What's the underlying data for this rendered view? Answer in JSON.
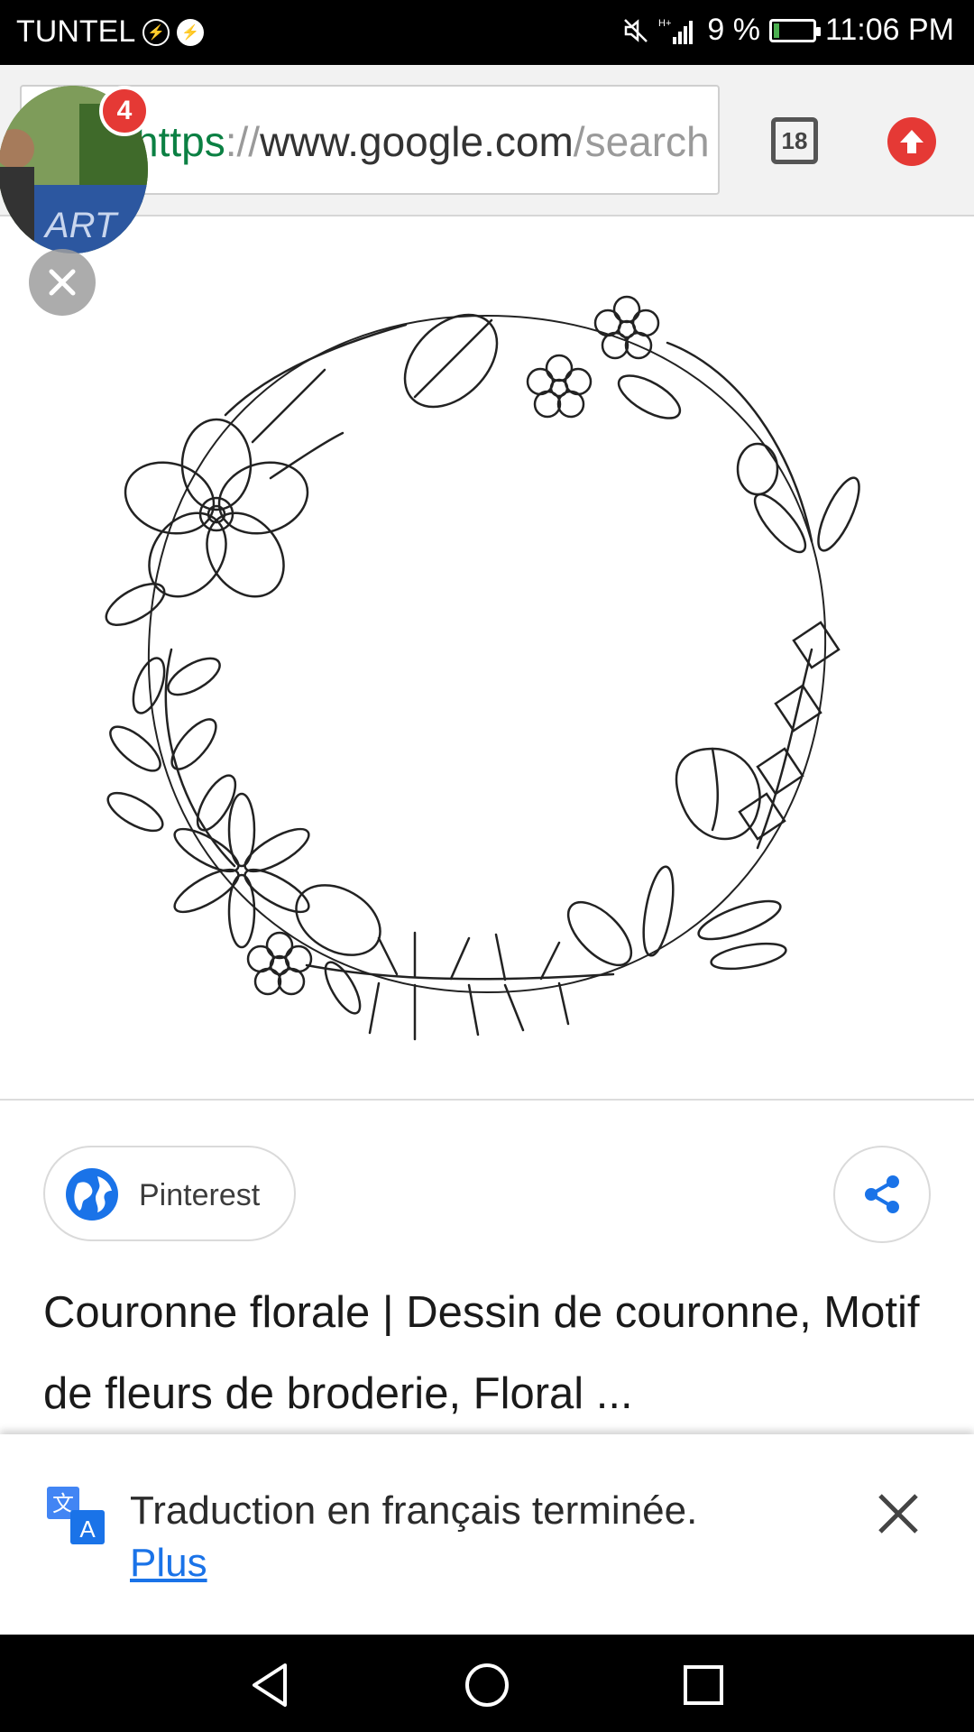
{
  "status_bar": {
    "carrier": "TUNTEL",
    "battery_percent": "9 %",
    "time": "11:06 PM",
    "icons": [
      "messenger-outline-icon",
      "messenger-icon",
      "mute-icon",
      "signal-icon",
      "battery-charging-icon"
    ]
  },
  "browser": {
    "url_scheme": "https",
    "url_sep": "://",
    "url_host": "www.google.com",
    "url_path": "/search",
    "tab_count": "18",
    "icons": [
      "tabs-icon",
      "update-arrow-icon"
    ]
  },
  "chat_head": {
    "badge_count": "4",
    "icons": [
      "avatar",
      "close-icon"
    ]
  },
  "result": {
    "source_label": "Pinterest",
    "title": "Couronne florale | Dessin de couronne, Motif de fleurs de broderie, Floral ...",
    "icons": [
      "globe-icon",
      "share-icon"
    ]
  },
  "translate_bar": {
    "message": "Traduction en français terminée.",
    "more_label": "Plus",
    "icons": [
      "translate-icon",
      "close-icon"
    ]
  },
  "nav_bar": {
    "icons": [
      "back-icon",
      "home-icon",
      "recents-icon"
    ]
  },
  "colors": {
    "accent_blue": "#1a73e8",
    "badge_red": "#e53935",
    "url_green": "#0b8043"
  }
}
